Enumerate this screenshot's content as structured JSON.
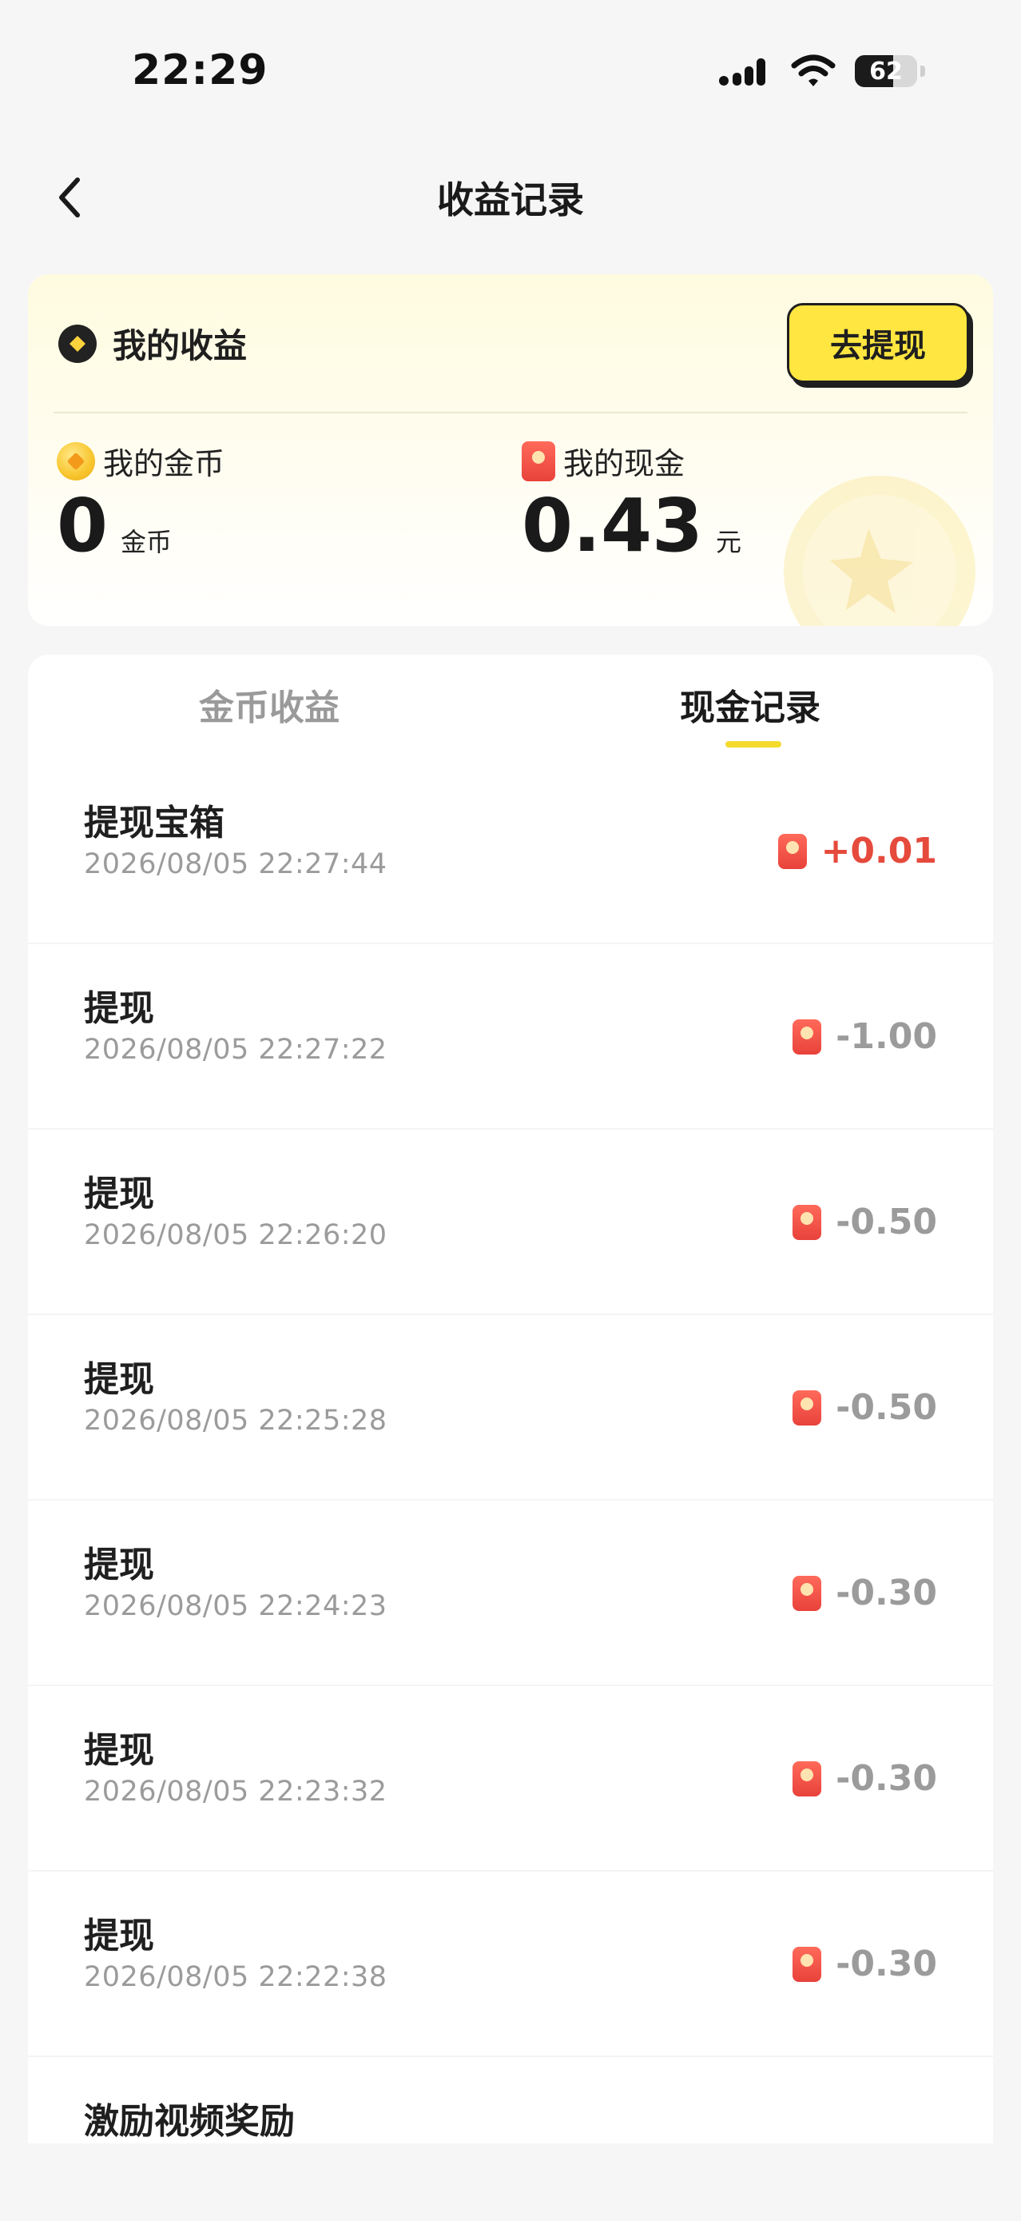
{
  "status_bar": {
    "time": "22:29",
    "battery": "62"
  },
  "nav": {
    "title": "收益记录"
  },
  "earnings": {
    "title": "我的收益",
    "withdraw_label": "去提现",
    "coins": {
      "label": "我的金币",
      "value": "0",
      "unit": "金币"
    },
    "cash": {
      "label": "我的现金",
      "value": "0.43",
      "unit": "元"
    }
  },
  "tabs": [
    {
      "label": "金币收益",
      "active": false
    },
    {
      "label": "现金记录",
      "active": true
    }
  ],
  "records": [
    {
      "title": "提现宝箱",
      "time": "2026/08/05 22:27:44",
      "amount": "+0.01",
      "positive": true
    },
    {
      "title": "提现",
      "time": "2026/08/05 22:27:22",
      "amount": "-1.00",
      "positive": false
    },
    {
      "title": "提现",
      "time": "2026/08/05 22:26:20",
      "amount": "-0.50",
      "positive": false
    },
    {
      "title": "提现",
      "time": "2026/08/05 22:25:28",
      "amount": "-0.50",
      "positive": false
    },
    {
      "title": "提现",
      "time": "2026/08/05 22:24:23",
      "amount": "-0.30",
      "positive": false
    },
    {
      "title": "提现",
      "time": "2026/08/05 22:23:32",
      "amount": "-0.30",
      "positive": false
    },
    {
      "title": "提现",
      "time": "2026/08/05 22:22:38",
      "amount": "-0.30",
      "positive": false
    },
    {
      "title": "激励视频奖励",
      "time": "",
      "amount": "",
      "positive": true
    }
  ],
  "colors": {
    "accent_yellow": "#ffe640",
    "positive_red": "#e54a3c",
    "muted_gray": "#9b9b9b"
  }
}
